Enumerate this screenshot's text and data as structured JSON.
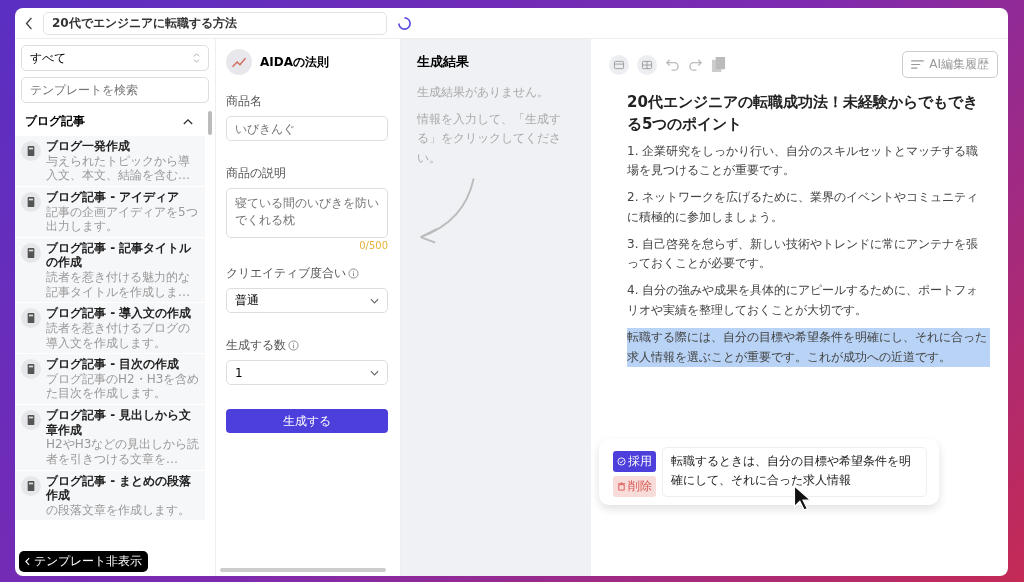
{
  "topbar": {
    "title": "20代でエンジニアに転職する方法",
    "loading": true
  },
  "sidebar": {
    "filter": "すべて",
    "search_placeholder": "テンプレートを検索",
    "category": {
      "title": "ブログ記事",
      "expanded": true
    },
    "items": [
      {
        "title": "ブログ一発作成",
        "description": "与えられたトピックから導入文、本文、結論を含む…"
      },
      {
        "title": "ブログ記事 - アイディア",
        "description": "記事の企画アイディアを5つ出力します。"
      },
      {
        "title": "ブログ記事 - 記事タイトルの作成",
        "description": "読者を惹き付ける魅力的な記事タイトルを作成しま…"
      },
      {
        "title": "ブログ記事 - 導入文の作成",
        "description": "読者を惹き付けるブログの導入文を作成します。"
      },
      {
        "title": "ブログ記事 - 目次の作成",
        "description": "ブログ記事のH2・H3を含めた目次を作成します。"
      },
      {
        "title": "ブログ記事 - 見出しから文章作成",
        "description": "H2やH3などの見出しから読者を引きつける文章を…"
      },
      {
        "title": "ブログ記事 - まとめの段落作成",
        "description": "の段落文章を作成します。"
      }
    ],
    "hide_button": "テンプレート非表示"
  },
  "form": {
    "title": "AIDAの法則",
    "fields": [
      {
        "kind": "input",
        "label": "商品名",
        "placeholder": "いびきんぐ"
      },
      {
        "kind": "textarea",
        "label": "商品の説明",
        "placeholder": "寝ている間のいびきを防いでくれる枕",
        "counter": "0/500"
      },
      {
        "kind": "select",
        "label": "クリエイティブ度合い",
        "value": "普通",
        "info": true
      },
      {
        "kind": "select",
        "label": "生成する数",
        "value": "1",
        "info": true
      }
    ],
    "submit": "生成する"
  },
  "results": {
    "title": "生成結果",
    "empty": "生成結果がありません。",
    "hint": "情報を入力して、「生成する」をクリックしてください。"
  },
  "editor": {
    "history_button": "AI編集履歴",
    "blocks": [
      {
        "kind": "heading",
        "text": "20代エンジニアの転職成功法！未経験からでもできる5つのポイント",
        "selected": false
      },
      {
        "kind": "paragraph",
        "text": "1. 企業研究をしっかり行い、自分のスキルセットとマッチする職場を見つけることが重要です。",
        "selected": false
      },
      {
        "kind": "paragraph",
        "text": "2. ネットワークを広げるために、業界のイベントやコミュニティに積極的に参加しましょう。",
        "selected": false
      },
      {
        "kind": "paragraph",
        "text": "3. 自己啓発を怠らず、新しい技術やトレンドに常にアンテナを張っておくことが必要です。",
        "selected": false
      },
      {
        "kind": "paragraph",
        "text": "4. 自分の強みや成果を具体的にアピールするために、ポートフォリオや実績を整理しておくことが大切です。",
        "selected": false
      },
      {
        "kind": "paragraph",
        "text": "転職する際には、自分の目標や希望条件を明確にし、それに合った求人情報を選ぶことが重要です。これが成功への近道です。",
        "selected": true
      }
    ],
    "suggestion": {
      "accept": "採用",
      "delete": "削除",
      "text": "転職するときは、自分の目標や希望条件を明確にして、それに合った求人情報"
    }
  }
}
